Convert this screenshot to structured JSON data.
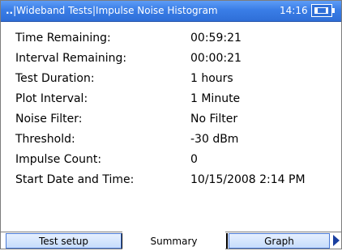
{
  "header": {
    "breadcrumb_prefix": "..",
    "breadcrumb_path": "|Wideband Tests|Impulse Noise Histogram",
    "time": "14:16"
  },
  "summary": {
    "rows": [
      {
        "label": "Time Remaining:",
        "value": "00:59:21"
      },
      {
        "label": "Interval Remaining:",
        "value": "00:00:21"
      },
      {
        "label": "Test Duration:",
        "value": "1 hours"
      },
      {
        "label": "Plot Interval:",
        "value": "1 Minute"
      },
      {
        "label": "Noise Filter:",
        "value": "No Filter"
      },
      {
        "label": "Threshold:",
        "value": "-30 dBm"
      },
      {
        "label": "Impulse Count:",
        "value": "0"
      },
      {
        "label": "Start Date and Time:",
        "value": "10/15/2008 2:14 PM"
      }
    ]
  },
  "tabs": [
    {
      "label": "Test setup"
    },
    {
      "label": "Summary"
    },
    {
      "label": "Graph"
    }
  ],
  "icons": {
    "battery": "battery-icon",
    "scroll_right": "scroll-right-icon"
  },
  "colors": {
    "titlebar": "#3a7de6",
    "tab_border": "#4a7ad6"
  }
}
